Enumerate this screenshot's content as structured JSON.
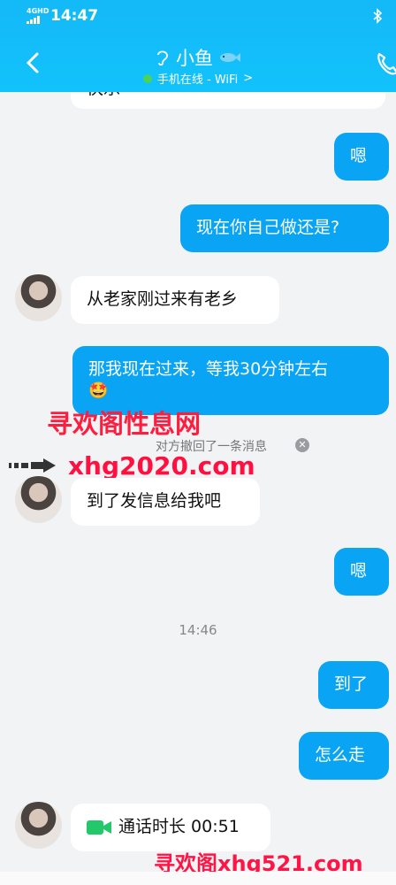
{
  "status_bar": {
    "time": "14:47",
    "network": "4GHD"
  },
  "header": {
    "title": "小鱼",
    "subtitle": "手机在线 - WiFi",
    "subtitle_chevron": ">"
  },
  "messages": [
    {
      "side": "left",
      "text": "快乐"
    },
    {
      "side": "right",
      "text": "嗯"
    },
    {
      "side": "right",
      "text": "现在你自己做还是?"
    },
    {
      "side": "left",
      "text": "从老家刚过来有老乡"
    },
    {
      "side": "right",
      "text": "那我现在过来，等我30分钟左右",
      "emoji": "🤩"
    },
    {
      "side": "system",
      "text": "对方撤回了一条消息"
    },
    {
      "side": "left",
      "text": "到了发信息给我吧"
    },
    {
      "side": "right",
      "text": "嗯"
    },
    {
      "side": "time",
      "text": "14:46"
    },
    {
      "side": "right",
      "text": "到了"
    },
    {
      "side": "right",
      "text": "怎么走"
    },
    {
      "side": "left",
      "text": "通话时长 00:51"
    }
  ],
  "watermarks": {
    "top": "寻欢阁性息网",
    "middle": "xhg2020.com",
    "bottom": "寻欢阁xhg521.com"
  },
  "icons": [
    "back-arrow-icon",
    "ear-icon",
    "fish-icon",
    "phone-icon",
    "bluetooth-icon",
    "close-icon",
    "video-call-icon"
  ],
  "colors": {
    "header": "#14b9f8",
    "bubble_right": "#0aa4f5",
    "bubble_left": "#ffffff",
    "online": "#49d35b"
  }
}
